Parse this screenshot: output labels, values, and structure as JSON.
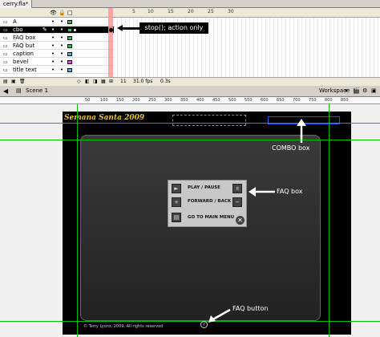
{
  "document_tab": "cerry.fla*",
  "timeline": {
    "ruler": [
      "5",
      "10",
      "15",
      "20",
      "25",
      "30"
    ],
    "layers": [
      {
        "name": "A",
        "color": "#2ec34a"
      },
      {
        "name": "cbo",
        "color": "#2ec34a"
      },
      {
        "name": "FAQ box",
        "color": "#2ec34a"
      },
      {
        "name": "FAQ but",
        "color": "#2ec34a"
      },
      {
        "name": "caption",
        "color": "#40b0ff"
      },
      {
        "name": "bevel",
        "color": "#ff40ff"
      },
      {
        "name": "title text",
        "color": "#40b0ff"
      }
    ],
    "footer": {
      "frame": "11",
      "fps": "31.0 fps",
      "time": "0.3s"
    },
    "callout": "stop(); action only"
  },
  "edit_bar": {
    "scene": "Scene 1",
    "workspace": "Workspace"
  },
  "stage_ruler": [
    "50",
    "100",
    "150",
    "200",
    "250",
    "300",
    "350",
    "400",
    "450",
    "500",
    "550",
    "600",
    "650",
    "700",
    "750",
    "800",
    "850"
  ],
  "movie": {
    "title": "Semana Santa 2009",
    "copyright": "© Terry Lyons, 2009.  All rights reserved",
    "faq": [
      {
        "label": "PLAY / PAUSE"
      },
      {
        "label": "FORWARD / BACK"
      },
      {
        "label": "GO TO MAIN MENU"
      }
    ]
  },
  "annotations": {
    "combo": "COMBO box",
    "faq_box": "FAQ box",
    "faq_button": "FAQ button"
  }
}
